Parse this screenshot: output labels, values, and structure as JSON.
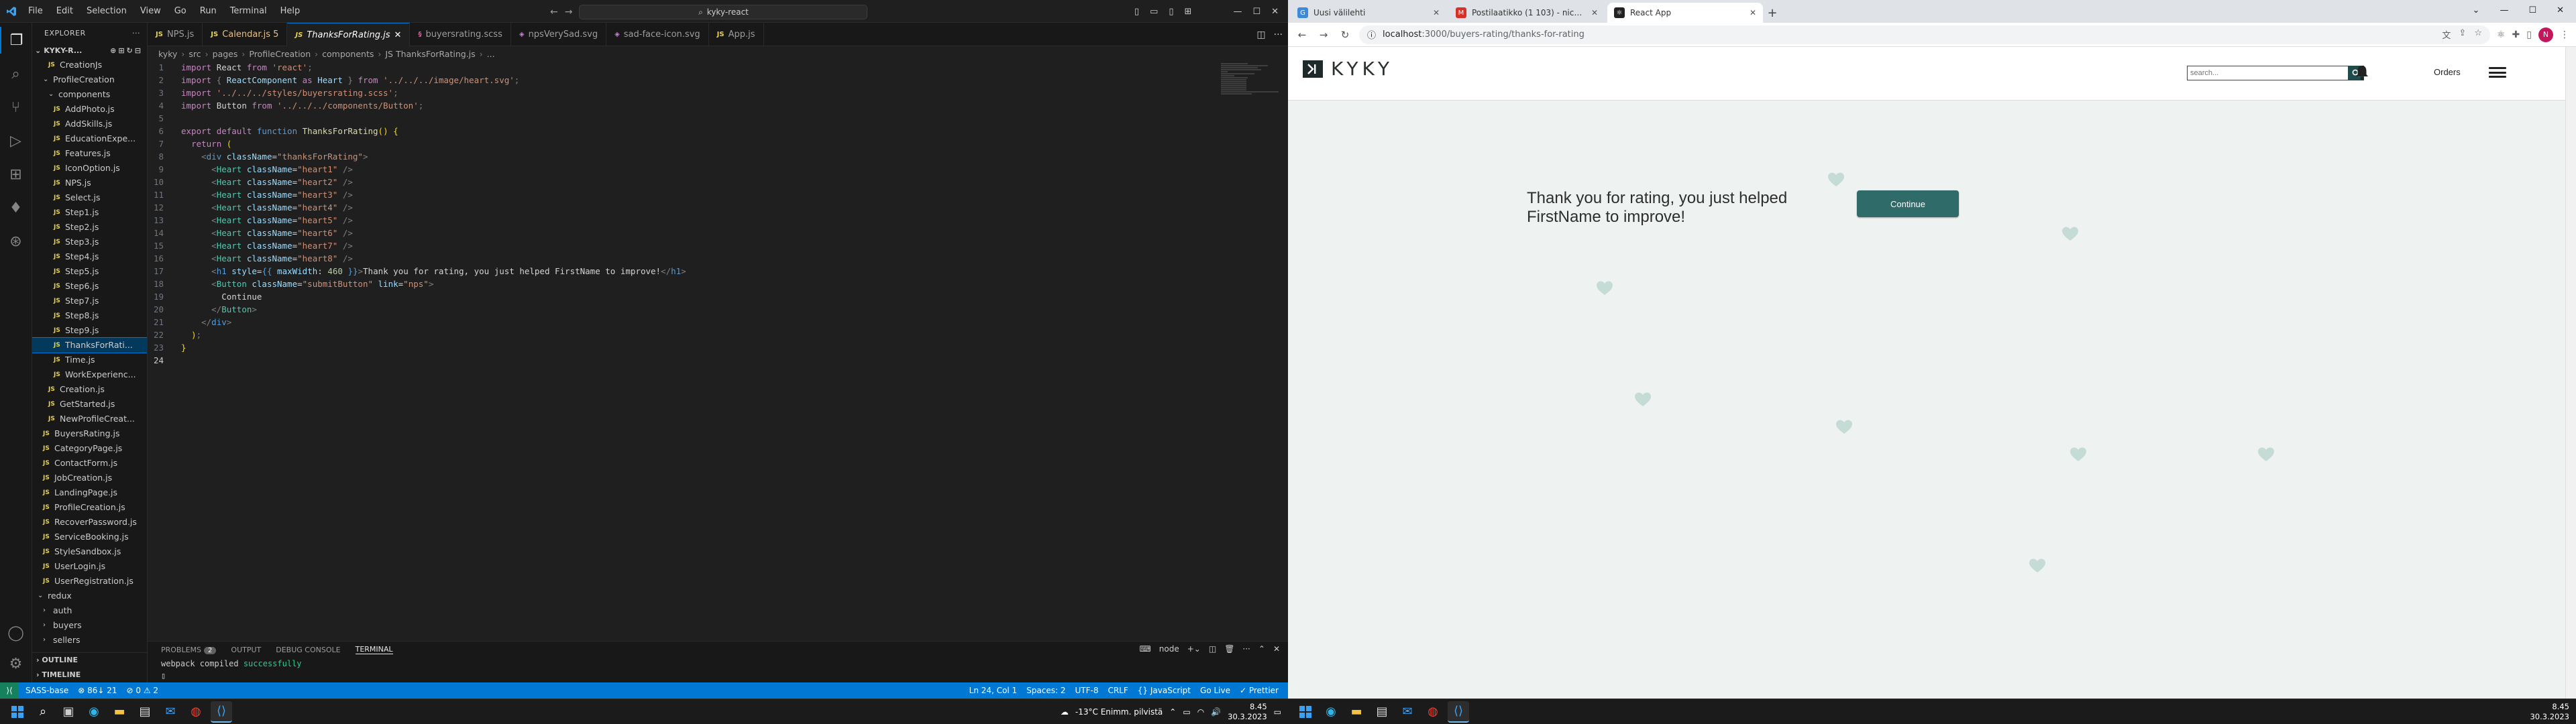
{
  "vscode": {
    "menu": [
      "File",
      "Edit",
      "Selection",
      "View",
      "Go",
      "Run",
      "Terminal",
      "Help"
    ],
    "command_center": "kyky-react",
    "explorer_title": "EXPLORER",
    "project_name": "KYKY-R...",
    "tree": [
      {
        "label": "CreationJs",
        "type": "js",
        "indent": 3
      },
      {
        "label": "ProfileCreation",
        "type": "folder-open",
        "indent": 2
      },
      {
        "label": "components",
        "type": "folder-open",
        "indent": 3
      },
      {
        "label": "AddPhoto.js",
        "type": "js",
        "indent": 4
      },
      {
        "label": "AddSkills.js",
        "type": "js",
        "indent": 4
      },
      {
        "label": "EducationExpe...",
        "type": "js",
        "indent": 4
      },
      {
        "label": "Features.js",
        "type": "js",
        "indent": 4
      },
      {
        "label": "IconOption.js",
        "type": "js",
        "indent": 4
      },
      {
        "label": "NPS.js",
        "type": "js",
        "indent": 4
      },
      {
        "label": "Select.js",
        "type": "js",
        "indent": 4
      },
      {
        "label": "Step1.js",
        "type": "js",
        "indent": 4
      },
      {
        "label": "Step2.js",
        "type": "js",
        "indent": 4
      },
      {
        "label": "Step3.js",
        "type": "js",
        "indent": 4
      },
      {
        "label": "Step4.js",
        "type": "js",
        "indent": 4
      },
      {
        "label": "Step5.js",
        "type": "js",
        "indent": 4
      },
      {
        "label": "Step6.js",
        "type": "js",
        "indent": 4
      },
      {
        "label": "Step7.js",
        "type": "js",
        "indent": 4
      },
      {
        "label": "Step8.js",
        "type": "js",
        "indent": 4
      },
      {
        "label": "Step9.js",
        "type": "js",
        "indent": 4
      },
      {
        "label": "ThanksForRati...",
        "type": "js",
        "indent": 4,
        "selected": true
      },
      {
        "label": "Time.js",
        "type": "js",
        "indent": 4
      },
      {
        "label": "WorkExperienc...",
        "type": "js",
        "indent": 4
      },
      {
        "label": "Creation.js",
        "type": "js",
        "indent": 3
      },
      {
        "label": "GetStarted.js",
        "type": "js",
        "indent": 3
      },
      {
        "label": "NewProfileCreat...",
        "type": "js",
        "indent": 3
      },
      {
        "label": "BuyersRating.js",
        "type": "js",
        "indent": 2
      },
      {
        "label": "CategoryPage.js",
        "type": "js",
        "indent": 2
      },
      {
        "label": "ContactForm.js",
        "type": "js",
        "indent": 2
      },
      {
        "label": "JobCreation.js",
        "type": "js",
        "indent": 2
      },
      {
        "label": "LandingPage.js",
        "type": "js",
        "indent": 2
      },
      {
        "label": "ProfileCreation.js",
        "type": "js",
        "indent": 2
      },
      {
        "label": "RecoverPassword.js",
        "type": "js",
        "indent": 2
      },
      {
        "label": "ServiceBooking.js",
        "type": "js",
        "indent": 2
      },
      {
        "label": "StyleSandbox.js",
        "type": "js",
        "indent": 2
      },
      {
        "label": "UserLogin.js",
        "type": "js",
        "indent": 2
      },
      {
        "label": "UserRegistration.js",
        "type": "js",
        "indent": 2
      },
      {
        "label": "redux",
        "type": "folder-open",
        "indent": 1
      },
      {
        "label": "auth",
        "type": "folder",
        "indent": 2
      },
      {
        "label": "buyers",
        "type": "folder",
        "indent": 2
      },
      {
        "label": "sellers",
        "type": "folder",
        "indent": 2
      }
    ],
    "outline_label": "OUTLINE",
    "timeline_label": "TIMELINE",
    "tabs": [
      {
        "label": "NPS.js",
        "kind": "js"
      },
      {
        "label": "Calendar.js 5",
        "kind": "js",
        "modified": true
      },
      {
        "label": "ThanksForRating.js",
        "kind": "js",
        "active": true
      },
      {
        "label": "buyersrating.scss",
        "kind": "scss"
      },
      {
        "label": "npsVerySad.svg",
        "kind": "svg"
      },
      {
        "label": "sad-face-icon.svg",
        "kind": "svg"
      },
      {
        "label": "App.js",
        "kind": "js"
      }
    ],
    "breadcrumb": [
      "kyky",
      "src",
      "pages",
      "ProfileCreation",
      "components",
      "JS ThanksForRating.js",
      "..."
    ],
    "code": [
      "<kw>import</kw> <txt>React</txt> <kw>from</kw> <str>'react'</str><punc>;</punc>",
      "<kw>import</kw> <punc>{</punc> <attr>ReactComponent</attr> <kw>as</kw> <attr>Heart</attr> <punc>}</punc> <kw>from</kw> <str>'../../../image/heart.svg'</str><punc>;</punc>",
      "<kw>import</kw> <str>'../../../styles/buyersrating.scss'</str><punc>;</punc>",
      "<kw>import</kw> <txt>Button</txt> <kw>from</kw> <str>'../../../components/Button'</str><punc>;</punc>",
      "",
      "<kw>export</kw> <kw>default</kw> <kw2>function</kw2> <fn>ThanksForRating</fn><yel>()</yel> <yel>{</yel>",
      "  <kw>return</kw> <yel>(</yel>",
      "    <punc>&lt;</punc><kw2>div</kw2> <attr>className</attr><txt>=</txt><str>\"thanksForRating\"</str><punc>&gt;</punc>",
      "      <punc>&lt;</punc><tag>Heart</tag> <attr>className</attr><txt>=</txt><str>\"heart1\"</str> <punc>/&gt;</punc>",
      "      <punc>&lt;</punc><tag>Heart</tag> <attr>className</attr><txt>=</txt><str>\"heart2\"</str> <punc>/&gt;</punc>",
      "      <punc>&lt;</punc><tag>Heart</tag> <attr>className</attr><txt>=</txt><str>\"heart3\"</str> <punc>/&gt;</punc>",
      "      <punc>&lt;</punc><tag>Heart</tag> <attr>className</attr><txt>=</txt><str>\"heart4\"</str> <punc>/&gt;</punc>",
      "      <punc>&lt;</punc><tag>Heart</tag> <attr>className</attr><txt>=</txt><str>\"heart5\"</str> <punc>/&gt;</punc>",
      "      <punc>&lt;</punc><tag>Heart</tag> <attr>className</attr><txt>=</txt><str>\"heart6\"</str> <punc>/&gt;</punc>",
      "      <punc>&lt;</punc><tag>Heart</tag> <attr>className</attr><txt>=</txt><str>\"heart7\"</str> <punc>/&gt;</punc>",
      "      <punc>&lt;</punc><tag>Heart</tag> <attr>className</attr><txt>=</txt><str>\"heart8\"</str> <punc>/&gt;</punc>",
      "      <punc>&lt;</punc><kw2>h1</kw2> <attr>style</attr><txt>=</txt><kw2>{{</kw2> <attr>maxWidth</attr><txt>:</txt> <num>460</num> <kw2>}}</kw2><punc>&gt;</punc><txt>Thank you for rating, you just helped FirstName to improve!</txt><punc>&lt;/</punc><kw2>h1</kw2><punc>&gt;</punc>",
      "      <punc>&lt;</punc><tag>Button</tag> <attr>className</attr><txt>=</txt><str>\"submitButton\"</str> <attr>link</attr><txt>=</txt><str>\"nps\"</str><punc>&gt;</punc>",
      "        <txt>Continue</txt>",
      "      <punc>&lt;/</punc><tag>Button</tag><punc>&gt;</punc>",
      "    <punc>&lt;/</punc><kw2>div</kw2><punc>&gt;</punc>",
      "  <yel>)</yel><punc>;</punc>",
      "<yel>}</yel>",
      ""
    ],
    "current_line": 24,
    "panel_tabs": [
      {
        "label": "PROBLEMS",
        "badge": "2"
      },
      {
        "label": "OUTPUT"
      },
      {
        "label": "DEBUG CONSOLE"
      },
      {
        "label": "TERMINAL",
        "active": true
      }
    ],
    "terminal_shell": "node",
    "terminal_lines": [
      "webpack compiled successfully"
    ],
    "terminal_prefix": "webpack compiled ",
    "terminal_ok": "successfully",
    "status_left": [
      "SASS-base",
      "⊗ 86↓ 21",
      "⊘ 0 ⚠ 2"
    ],
    "status_right": [
      "Ln 24, Col 1",
      "Spaces: 2",
      "UTF-8",
      "CRLF",
      "{} JavaScript",
      "Go Live",
      "✓ Prettier"
    ]
  },
  "taskbar_left": {
    "weather": "-13°C  Enimm. pilvistä",
    "time": "8.45",
    "date": "30.3.2023"
  },
  "browser": {
    "tabs": [
      {
        "label": "Uusi välilehti",
        "fav_color": "#3c8ad8",
        "fav": "G"
      },
      {
        "label": "Postilaatikko (1 103) - nicholas.m...",
        "fav_color": "#d93025",
        "fav": "M"
      },
      {
        "label": "React App",
        "fav_color": "#222222",
        "fav": "⚛",
        "active": true
      }
    ],
    "url_host": "localhost",
    "url_path": ":3000/buyers-rating/thanks-for-rating",
    "profile_initial": "N"
  },
  "app": {
    "logo_text": "KYKY",
    "search_placeholder": "search...",
    "orders_label": "Orders",
    "thanks_message": "Thank you for rating, you just helped FirstName to improve!",
    "continue_label": "Continue",
    "heart_color": "#c5dcd6"
  },
  "taskbar_right": {
    "time": "8.45",
    "date": "30.3.2023"
  }
}
